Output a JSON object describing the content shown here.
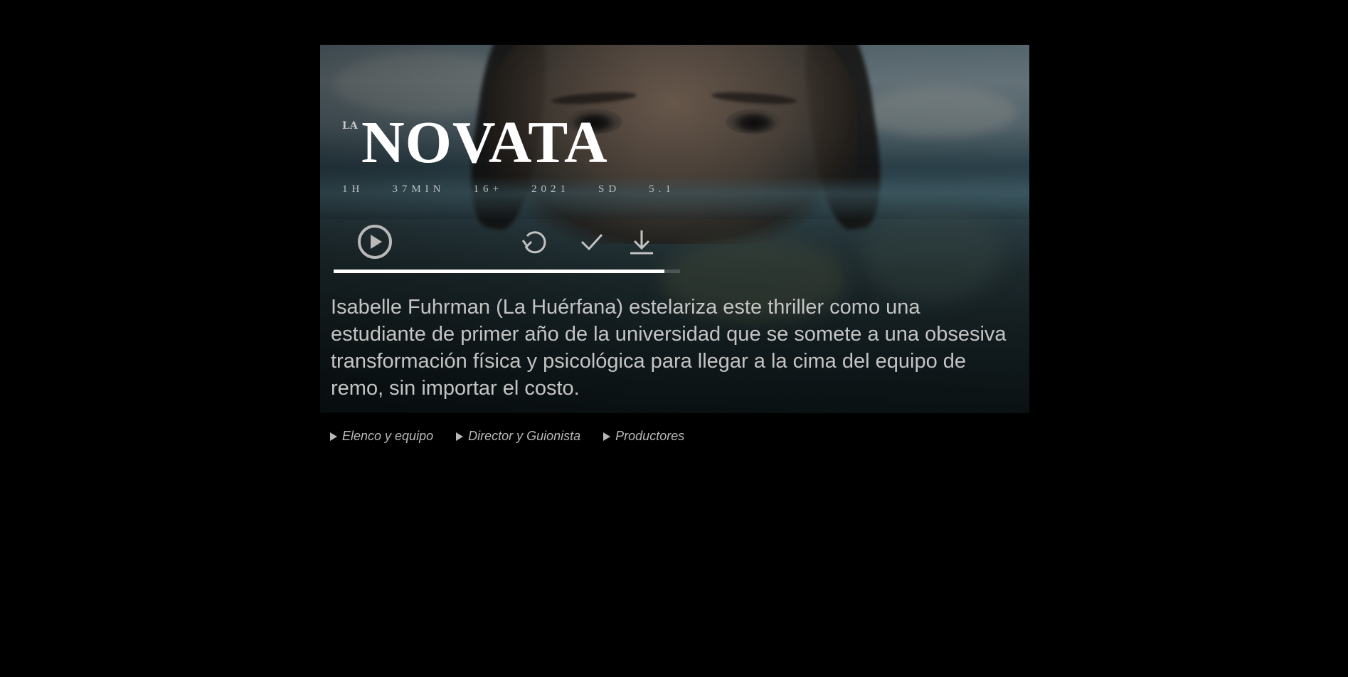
{
  "movie": {
    "title_prefix": "LA",
    "title": "NOVATA",
    "meta": [
      "1H",
      "37MIN",
      "16+",
      "2021",
      "SD",
      "5.1"
    ],
    "synopsis": "Isabelle Fuhrman (La Huérfana) estelariza este thriller como una estudiante de primer año de la universidad que se somete a una obsesiva transformación física y psicológica para llegar a la cima del equipo de remo, sin importar el costo."
  },
  "actions": {
    "play_icon": "play-circle-icon",
    "restart_icon": "restart-icon",
    "watched_icon": "check-icon",
    "download_icon": "download-icon"
  },
  "progress": {
    "fraction": 0.955
  },
  "credits": {
    "items": [
      "Elenco y equipo",
      "Director y Guionista",
      "Productores"
    ]
  },
  "colors": {
    "background": "#000000",
    "title": "#ffffff",
    "text": "#c4c4c4",
    "progress_fill": "#ffffff"
  }
}
